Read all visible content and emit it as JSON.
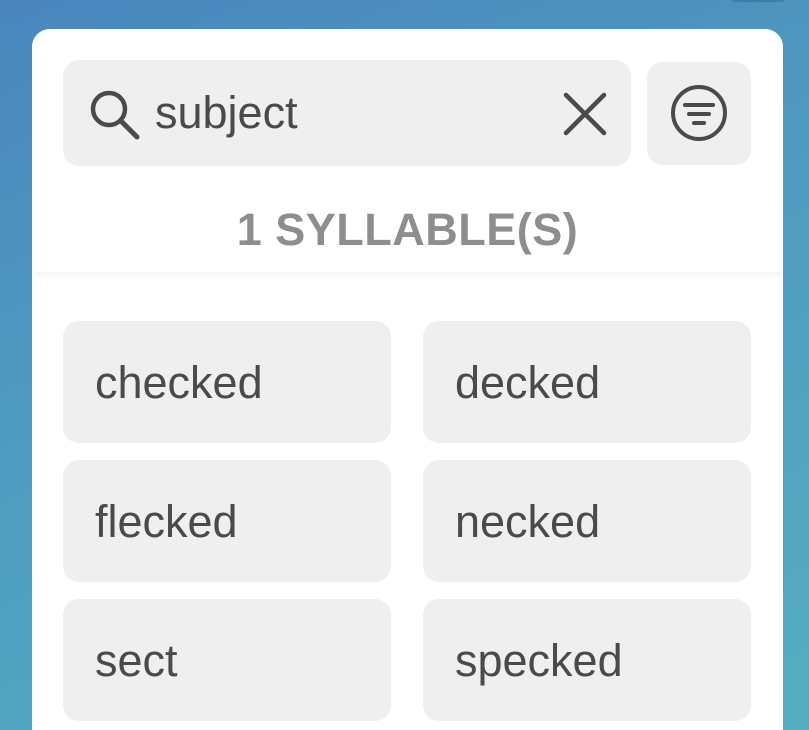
{
  "search": {
    "value": "subject",
    "icon": "search-icon",
    "clear_icon": "close-icon"
  },
  "filter": {
    "icon": "filter-icon"
  },
  "section": {
    "title": "1 SYLLABLE(S)"
  },
  "results": [
    {
      "word": "checked"
    },
    {
      "word": "decked"
    },
    {
      "word": "flecked"
    },
    {
      "word": "necked"
    },
    {
      "word": "sect"
    },
    {
      "word": "specked"
    }
  ],
  "colors": {
    "chip_background": "#efefef",
    "text": "#4a4a4a",
    "section_title": "#8e8e8e",
    "panel": "#ffffff"
  }
}
